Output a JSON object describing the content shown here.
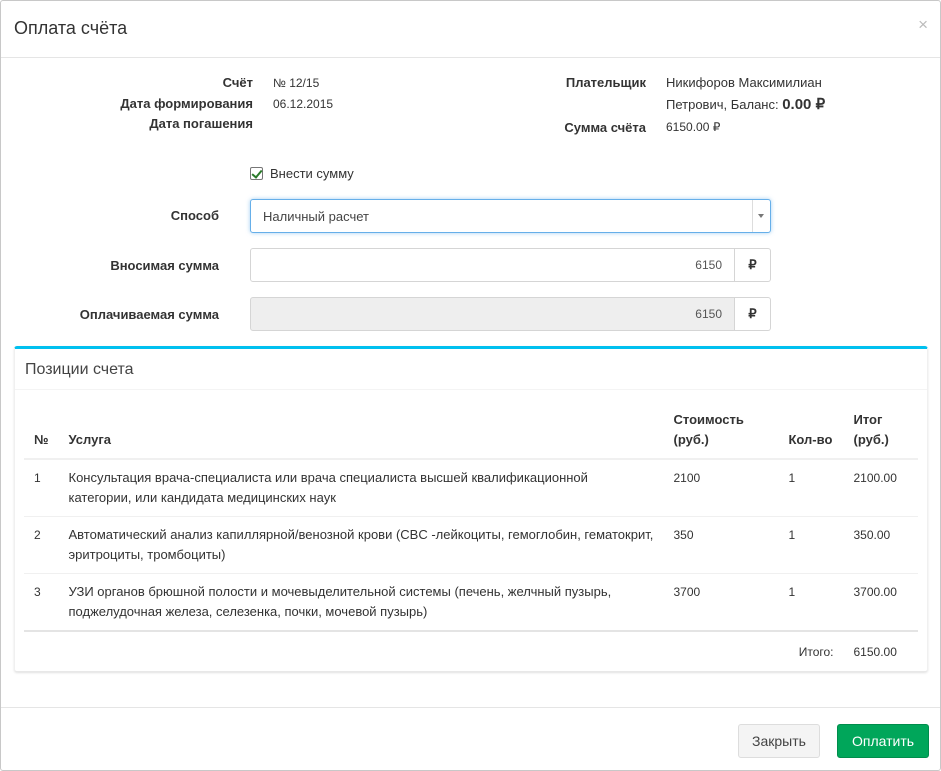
{
  "modal": {
    "title": "Оплата счёта",
    "close_icon": "close-icon"
  },
  "invoice": {
    "number_label": "Счёт",
    "number_value": "№ 12/15",
    "created_label": "Дата формирования",
    "created_value": "06.12.2015",
    "due_label": "Дата погашения",
    "due_value": "",
    "payer_label": "Плательщик",
    "payer_name_line1": "Никифоров Максимилиан",
    "payer_name_line2": "Петрович, Баланс: ",
    "payer_balance": "0.00 ₽",
    "sum_label": "Сумма счёта",
    "sum_value": "6150.00 ₽"
  },
  "form": {
    "deposit_checkbox_label": "Внести сумму",
    "deposit_checked": true,
    "method_label": "Способ",
    "method_value": "Наличный расчет",
    "deposit_amount_label": "Вносимая сумма",
    "deposit_amount_value": "6150",
    "paid_amount_label": "Оплачиваемая сумма",
    "paid_amount_value": "6150",
    "currency_symbol": "₽"
  },
  "positions": {
    "title": "Позиции счета",
    "columns": {
      "num": "№",
      "service": "Услуга",
      "cost": "Стоимость (руб.)",
      "qty": "Кол-во",
      "total": "Итог (руб.)"
    },
    "rows": [
      {
        "num": "1",
        "service": "Консультация врача-специалиста или врача специалиста высшей квалификационной категории, или кандидата медицинских наук",
        "cost": "2100",
        "qty": "1",
        "total": "2100.00"
      },
      {
        "num": "2",
        "service": "Автоматический анализ капиллярной/венозной крови (CBC -лейкоциты, гемоглобин, гематокрит, эритроциты, тромбоциты)",
        "cost": "350",
        "qty": "1",
        "total": "350.00"
      },
      {
        "num": "3",
        "service": "УЗИ органов брюшной полости и мочевыделительной системы (печень, желчный пузырь, поджелудочная железа, селезенка, почки, мочевой пузырь)",
        "cost": "3700",
        "qty": "1",
        "total": "3700.00"
      }
    ],
    "total_label": "Итого:",
    "total_value": "6150.00"
  },
  "footer": {
    "close_label": "Закрыть",
    "pay_label": "Оплатить"
  }
}
